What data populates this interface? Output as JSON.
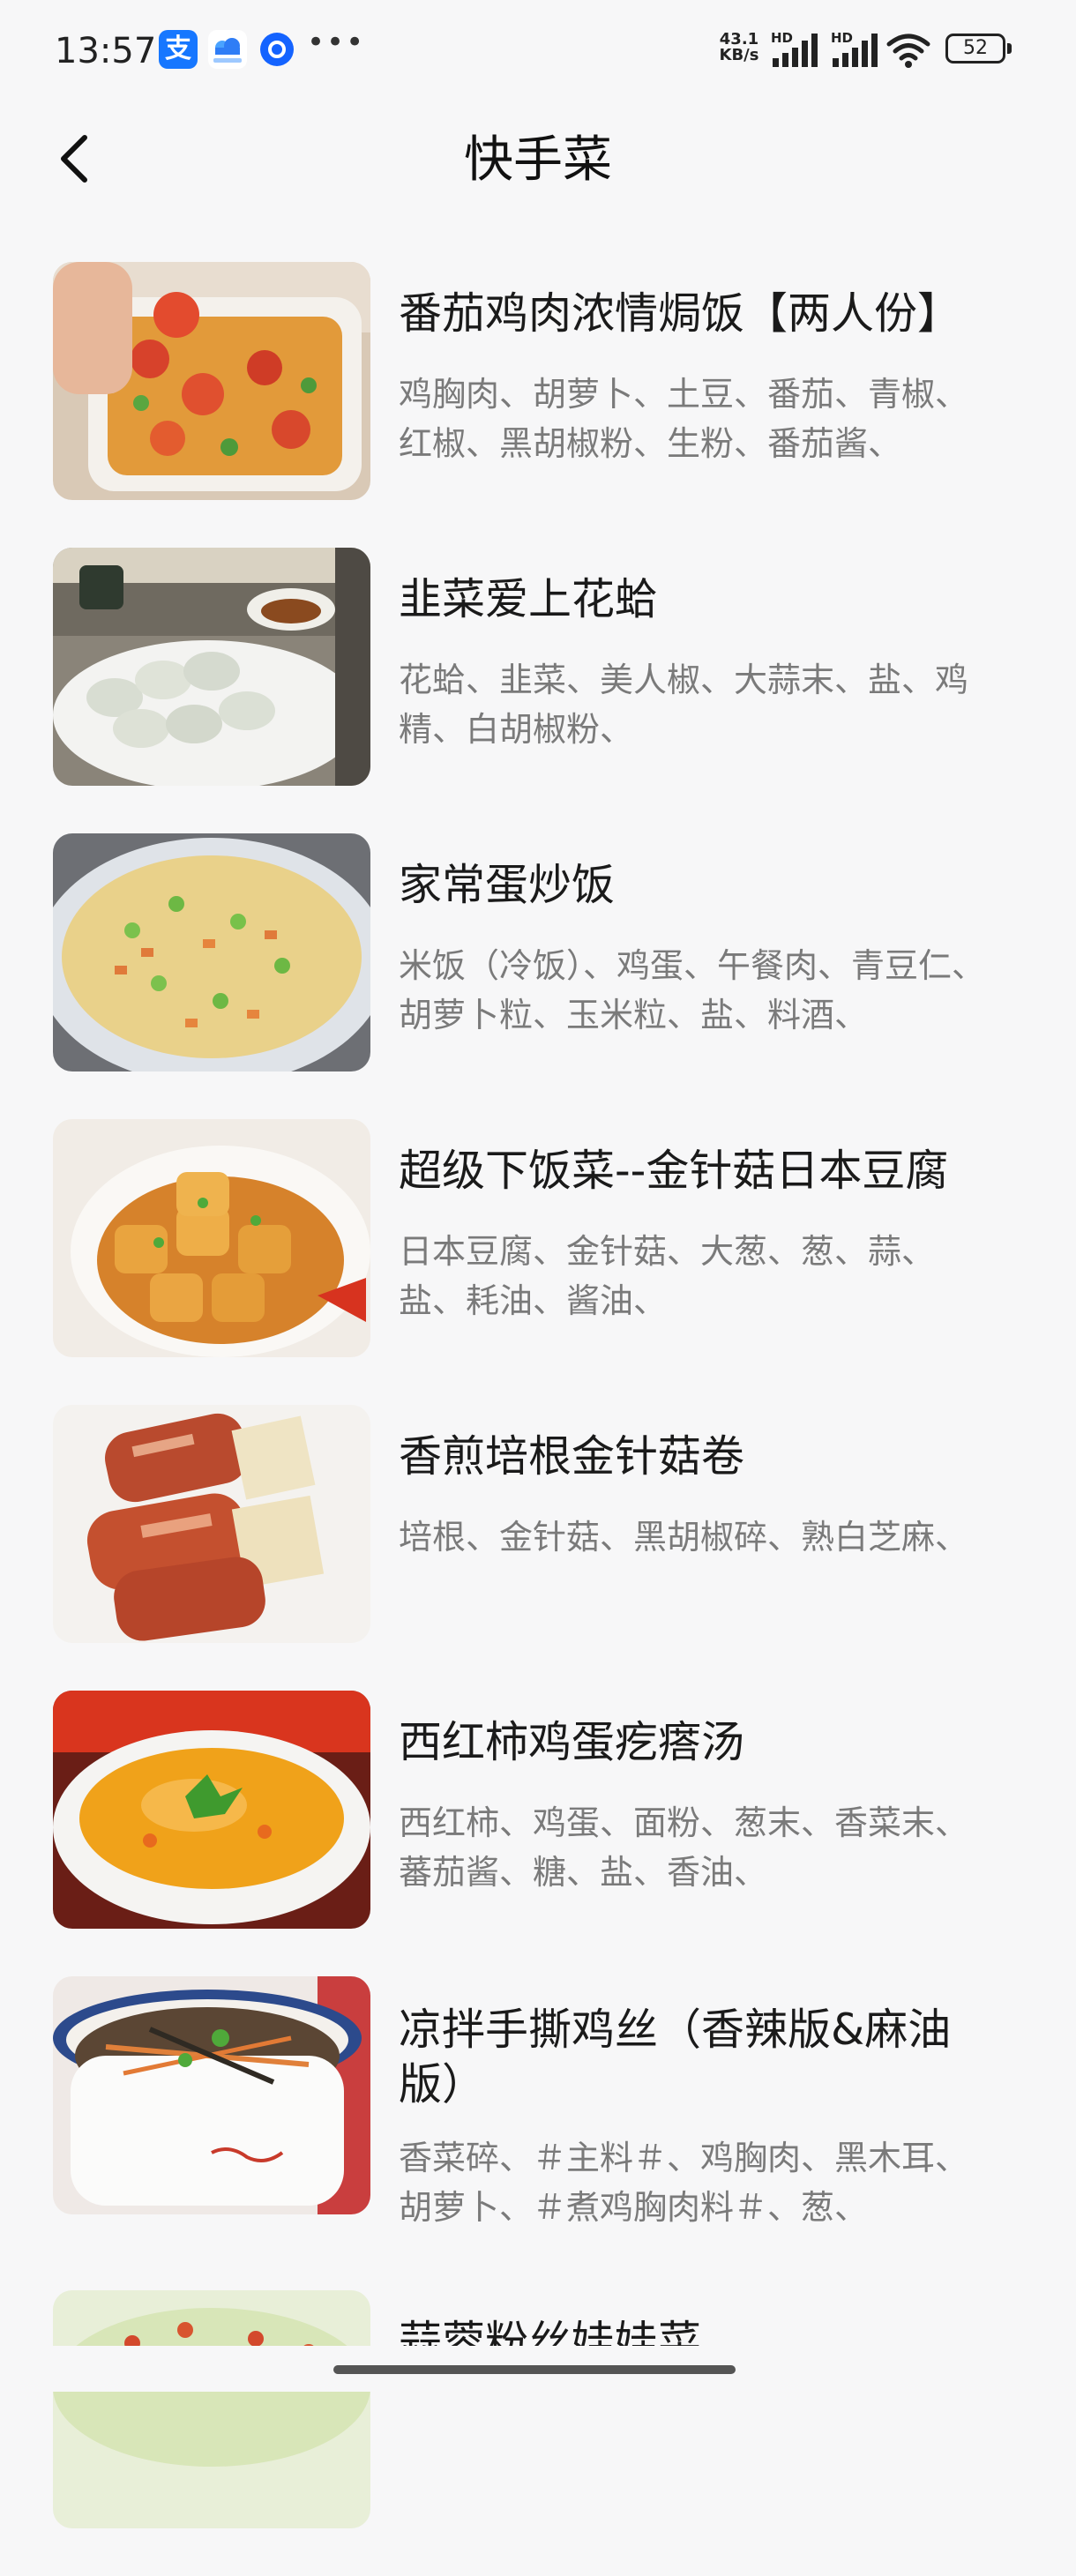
{
  "status_bar": {
    "time": "13:57",
    "alipay_label": "支",
    "network_speed": "43.1\nKB/s",
    "signal_label_1": "HD",
    "signal_label_2": "HD",
    "battery": "52"
  },
  "header": {
    "title": "快手菜"
  },
  "recipes": [
    {
      "title": "番茄鸡肉浓情焗饭【两人份】",
      "ingredients": "鸡胸肉、胡萝卜、土豆、番茄、青椒、红椒、黑胡椒粉、生粉、番茄酱、"
    },
    {
      "title": "韭菜爱上花蛤",
      "ingredients": "花蛤、韭菜、美人椒、大蒜末、盐、鸡精、白胡椒粉、"
    },
    {
      "title": "家常蛋炒饭",
      "ingredients": "米饭（冷饭）、鸡蛋、午餐肉、青豆仁、胡萝卜粒、玉米粒、盐、料酒、"
    },
    {
      "title": "超级下饭菜--金针菇日本豆腐",
      "ingredients": "日本豆腐、金针菇、大葱、葱、蒜、盐、耗油、酱油、"
    },
    {
      "title": "香煎培根金针菇卷",
      "ingredients": "培根、金针菇、黑胡椒碎、熟白芝麻、"
    },
    {
      "title": "西红柿鸡蛋疙瘩汤",
      "ingredients": "西红柿、鸡蛋、面粉、葱末、香菜末、蕃茄酱、糖、盐、香油、"
    },
    {
      "title": "凉拌手撕鸡丝（香辣版&麻油版）",
      "ingredients": "香菜碎、＃主料＃、鸡胸肉、黑木耳、胡萝卜、＃煮鸡胸肉料＃、葱、"
    },
    {
      "title": "蒜蓉粉丝娃娃菜",
      "ingredients": ""
    }
  ]
}
